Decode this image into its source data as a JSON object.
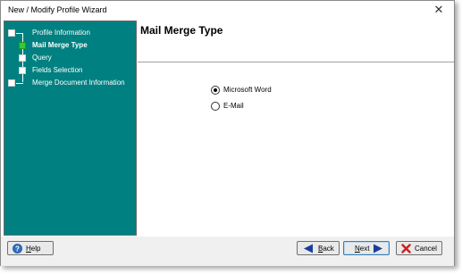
{
  "window": {
    "title": "New / Modify Profile Wizard",
    "close_glyph": "✕"
  },
  "sidebar": {
    "items": [
      {
        "label": "Profile Information",
        "state": "done"
      },
      {
        "label": "Mail Merge Type",
        "state": "current"
      },
      {
        "label": "Query",
        "state": "pending"
      },
      {
        "label": "Fields Selection",
        "state": "pending"
      },
      {
        "label": "Merge Document Information",
        "state": "pending"
      }
    ]
  },
  "main": {
    "heading": "Mail Merge Type",
    "options": [
      {
        "label": "Microsoft Word",
        "selected": true
      },
      {
        "label": "E-Mail",
        "selected": false
      }
    ]
  },
  "footer": {
    "help": {
      "first": "H",
      "rest": "elp",
      "icon": "question-icon"
    },
    "back": {
      "first": "B",
      "rest": "ack",
      "icon": "arrow-left-icon"
    },
    "next": {
      "first": "N",
      "rest": "ext",
      "icon": "arrow-right-icon"
    },
    "cancel": {
      "label": "Cancel",
      "icon": "red-x-icon"
    }
  },
  "colors": {
    "sidebar_bg": "#008080",
    "active_step": "#33cc33",
    "arrow_blue": "#1a3d9e",
    "cancel_red": "#cc1f1f"
  }
}
